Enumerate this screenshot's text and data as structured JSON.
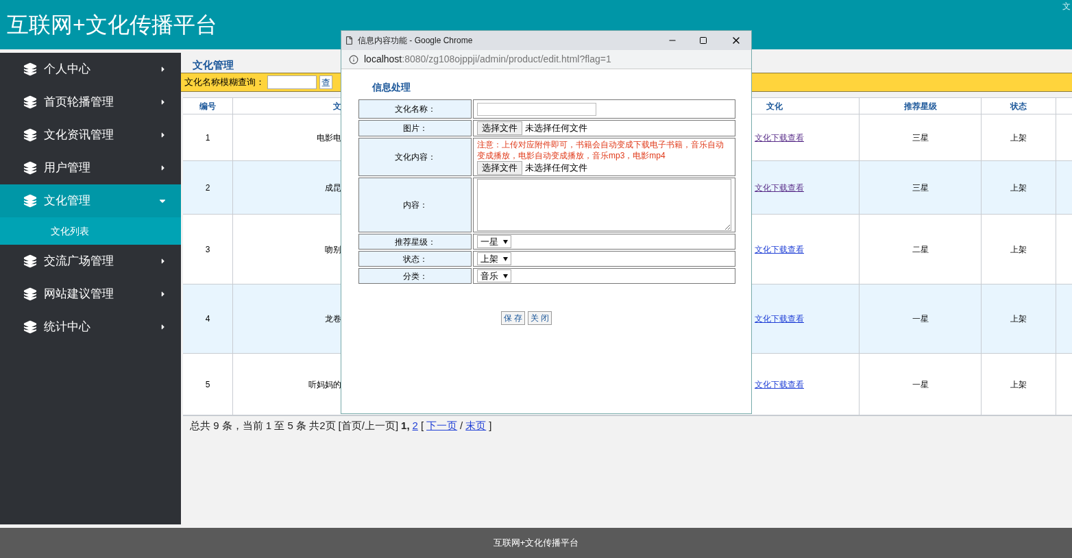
{
  "header": {
    "title": "互联网+文化传播平台",
    "corner_text": "文"
  },
  "sidebar": {
    "items": [
      {
        "label": "个人中心",
        "expanded": false,
        "selected": false
      },
      {
        "label": "首页轮播管理",
        "expanded": false,
        "selected": false
      },
      {
        "label": "文化资讯管理",
        "expanded": false,
        "selected": false
      },
      {
        "label": "用户管理",
        "expanded": false,
        "selected": false
      },
      {
        "label": "文化管理",
        "expanded": true,
        "selected": true,
        "children": [
          {
            "label": "文化列表"
          }
        ]
      },
      {
        "label": "交流广场管理",
        "expanded": false,
        "selected": false
      },
      {
        "label": "网站建议管理",
        "expanded": false,
        "selected": false
      },
      {
        "label": "统计中心",
        "expanded": false,
        "selected": false
      }
    ]
  },
  "page": {
    "title": "文化管理",
    "search": {
      "label": "文化名称模糊查询：",
      "button": "查"
    }
  },
  "table": {
    "columns": [
      "编号",
      "文",
      "文化",
      "推荐星级",
      "状态"
    ],
    "rows": [
      {
        "id": "1",
        "name": "电影电",
        "link": "文化下载查看",
        "visited": true,
        "stars": "三星",
        "status": "上架"
      },
      {
        "id": "2",
        "name": "成昆",
        "link": "文化下载查看",
        "visited": true,
        "stars": "三星",
        "status": "上架"
      },
      {
        "id": "3",
        "name": "吻别",
        "link": "文化下载查看",
        "visited": false,
        "stars": "二星",
        "status": "上架"
      },
      {
        "id": "4",
        "name": "龙卷",
        "link": "文化下载查看",
        "visited": false,
        "stars": "一星",
        "status": "上架"
      },
      {
        "id": "5",
        "name": "听妈妈的",
        "link": "文化下载查看",
        "visited": false,
        "stars": "一星",
        "status": "上架"
      }
    ]
  },
  "pager": [
    {
      "kind": "text",
      "text": "总共 9 条，当前 1 至 5 条 共2页"
    },
    {
      "kind": "text",
      "text": "[首页/上一页]"
    },
    {
      "kind": "bold",
      "text": "1,"
    },
    {
      "kind": "link",
      "text": "2"
    },
    {
      "kind": "text",
      "text": "["
    },
    {
      "kind": "link",
      "text": "下一页"
    },
    {
      "kind": "text",
      "text": "/"
    },
    {
      "kind": "link",
      "text": "末页"
    },
    {
      "kind": "text",
      "text": "]"
    }
  ],
  "popup": {
    "title": "信息内容功能 - Google Chrome",
    "url_host": "localhost",
    "url_path": ":8080/zg108ojppji/admin/product/edit.html?flag=1",
    "heading": "信息处理",
    "fields": [
      {
        "kind": "text",
        "label": "文化名称："
      },
      {
        "kind": "file",
        "label": "图片：",
        "button": "选择文件",
        "value": "未选择任何文件"
      },
      {
        "kind": "file",
        "label": "文化内容：",
        "note": "注意：上传对应附件即可，书籍会自动变成下载电子书籍，音乐自动变成播放，电影自动变成播放，音乐mp3，电影mp4",
        "button": "选择文件",
        "value": "未选择任何文件"
      },
      {
        "kind": "textarea",
        "label": "内容："
      },
      {
        "kind": "select",
        "label": "推荐星级：",
        "value": "一星"
      },
      {
        "kind": "select",
        "label": "状态：",
        "value": "上架"
      },
      {
        "kind": "select",
        "label": "分类：",
        "value": "音乐"
      }
    ],
    "buttons": [
      "保 存",
      "关 闭"
    ]
  },
  "footer": {
    "text": "互联网+文化传播平台"
  }
}
